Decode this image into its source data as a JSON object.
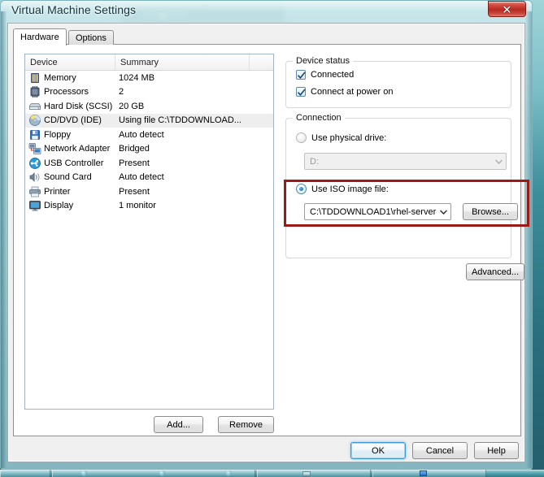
{
  "window": {
    "title": "Virtual Machine Settings",
    "close_icon": "close-x-icon"
  },
  "tabs": [
    {
      "label": "Hardware",
      "active": true
    },
    {
      "label": "Options",
      "active": false
    }
  ],
  "device_list": {
    "columns": [
      "Device",
      "Summary",
      ""
    ],
    "rows": [
      {
        "icon": "memory-icon",
        "device": "Memory",
        "summary": "1024 MB",
        "selected": false
      },
      {
        "icon": "processor-icon",
        "device": "Processors",
        "summary": "2",
        "selected": false
      },
      {
        "icon": "hard-disk-icon",
        "device": "Hard Disk (SCSI)",
        "summary": "20 GB",
        "selected": false
      },
      {
        "icon": "cd-dvd-icon",
        "device": "CD/DVD (IDE)",
        "summary": "Using file C:\\TDDOWNLOAD...",
        "selected": true
      },
      {
        "icon": "floppy-icon",
        "device": "Floppy",
        "summary": "Auto detect",
        "selected": false
      },
      {
        "icon": "network-adapter-icon",
        "device": "Network Adapter",
        "summary": "Bridged",
        "selected": false
      },
      {
        "icon": "usb-icon",
        "device": "USB Controller",
        "summary": "Present",
        "selected": false
      },
      {
        "icon": "sound-card-icon",
        "device": "Sound Card",
        "summary": "Auto detect",
        "selected": false
      },
      {
        "icon": "printer-icon",
        "device": "Printer",
        "summary": "Present",
        "selected": false
      },
      {
        "icon": "display-icon",
        "device": "Display",
        "summary": "1 monitor",
        "selected": false
      }
    ]
  },
  "list_buttons": {
    "add": "Add...",
    "remove": "Remove"
  },
  "device_status": {
    "title": "Device status",
    "connected": {
      "label": "Connected",
      "checked": true
    },
    "connect_at_power_on": {
      "label": "Connect at power on",
      "checked": true
    }
  },
  "connection": {
    "title": "Connection",
    "physical_drive": {
      "label": "Use physical drive:",
      "selected": false,
      "value": "D:",
      "disabled": true,
      "arrow_icon": "chevron-down-icon"
    },
    "iso_image": {
      "label": "Use ISO image file:",
      "selected": true,
      "value": "C:\\TDDOWNLOAD1\\rhel-server-",
      "placeholder": "",
      "arrow_icon": "chevron-down-icon",
      "browse_label": "Browse..."
    },
    "advanced_label": "Advanced..."
  },
  "annotation": {
    "type": "highlight-rectangle",
    "color": "#9b1a16",
    "target": "iso-image-file-row"
  },
  "dialog_buttons": {
    "ok": "OK",
    "cancel": "Cancel",
    "help": "Help"
  },
  "theme": {
    "glass": "#b2d8de",
    "accent_focus": "#3c9ad1",
    "close_red": "#b62a21",
    "selection_gray": "#eeeeee"
  }
}
